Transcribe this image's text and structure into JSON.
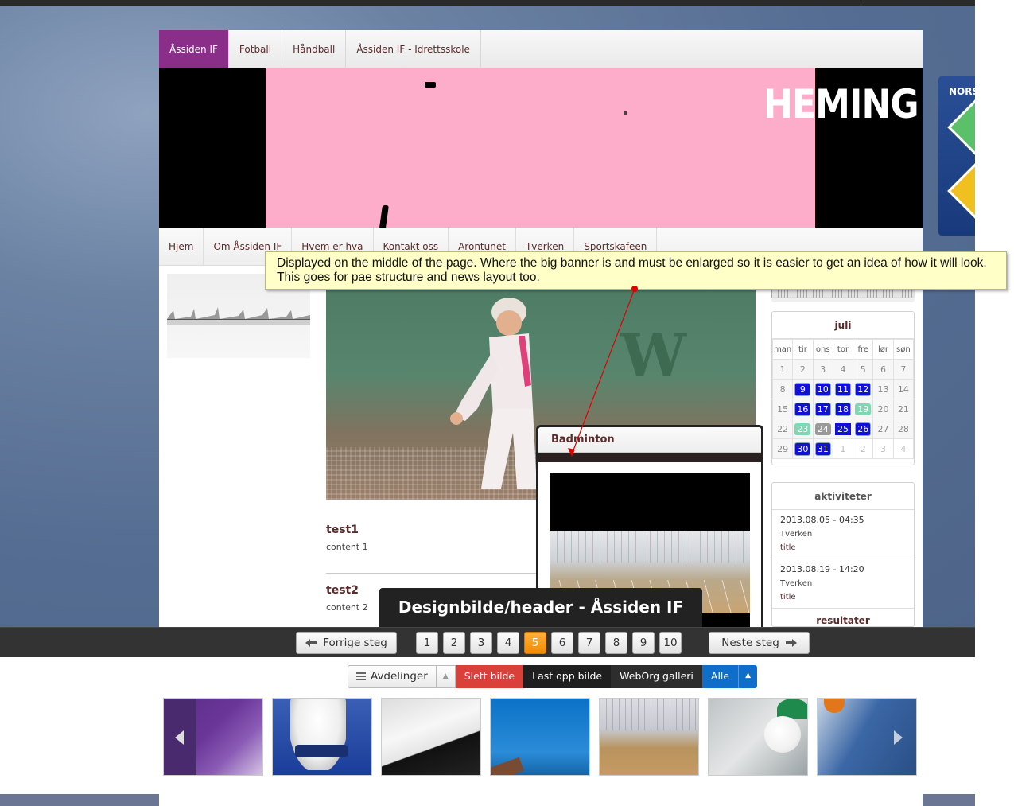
{
  "site": {
    "top_nav": [
      "Åssiden IF",
      "Fotball",
      "Håndball",
      "Åssiden IF - Idrettsskole"
    ],
    "banner_logo": "HEMING",
    "sub_nav": [
      "Hjem",
      "Om Åssiden IF",
      "Hvem er hva",
      "Kontakt oss",
      "Arontunet",
      "Tverken",
      "Sportskafeen"
    ]
  },
  "side_ad": {
    "label": "NORS"
  },
  "articles": [
    {
      "title": "test1",
      "content": "content 1"
    },
    {
      "title": "test2",
      "content": "content 2"
    }
  ],
  "calendar": {
    "month": "juli",
    "weekdays": [
      "man",
      "tir",
      "ons",
      "tor",
      "fre",
      "lør",
      "søn"
    ],
    "weeks": [
      [
        {
          "d": "1"
        },
        {
          "d": "2"
        },
        {
          "d": "3"
        },
        {
          "d": "4"
        },
        {
          "d": "5"
        },
        {
          "d": "6"
        },
        {
          "d": "7"
        }
      ],
      [
        {
          "d": "8"
        },
        {
          "d": "9",
          "s": "ev"
        },
        {
          "d": "10",
          "s": "ev"
        },
        {
          "d": "11",
          "s": "ev"
        },
        {
          "d": "12",
          "s": "ev"
        },
        {
          "d": "13"
        },
        {
          "d": "14"
        }
      ],
      [
        {
          "d": "15"
        },
        {
          "d": "16",
          "s": "ev"
        },
        {
          "d": "17",
          "s": "ev"
        },
        {
          "d": "18",
          "s": "ev"
        },
        {
          "d": "19",
          "s": "green"
        },
        {
          "d": "20"
        },
        {
          "d": "21"
        }
      ],
      [
        {
          "d": "22"
        },
        {
          "d": "23",
          "s": "green"
        },
        {
          "d": "24",
          "s": "gray"
        },
        {
          "d": "25",
          "s": "today"
        },
        {
          "d": "26",
          "s": "ev"
        },
        {
          "d": "27"
        },
        {
          "d": "28"
        }
      ],
      [
        {
          "d": "29"
        },
        {
          "d": "30",
          "s": "ev"
        },
        {
          "d": "31",
          "s": "ev"
        },
        {
          "d": "1",
          "s": "dim"
        },
        {
          "d": "2",
          "s": "dim"
        },
        {
          "d": "3",
          "s": "dim"
        },
        {
          "d": "4",
          "s": "dim"
        }
      ]
    ]
  },
  "activities": {
    "title": "aktiviteter",
    "entries": [
      {
        "date": "2013.08.05 - 04:35",
        "place": "Tverken",
        "title": "title"
      },
      {
        "date": "2013.08.19 - 14:20",
        "place": "Tverken",
        "title": "title"
      }
    ],
    "results_title": "resultater"
  },
  "popup": {
    "title": "Badminton"
  },
  "note": {
    "line1": "Displayed on the middle of the page. Where the big banner is and must be enlarged so it is easier to get an idea of how it will look.",
    "line2": "This goes for pae structure and news layout too."
  },
  "caption": "Designbilde/header - Åssiden IF",
  "steps": {
    "prev_label": "Forrige steg",
    "next_label": "Neste steg",
    "pages": [
      "1",
      "2",
      "3",
      "4",
      "5",
      "6",
      "7",
      "8",
      "9",
      "10"
    ],
    "current": "5"
  },
  "toolbar": {
    "departments": "Avdelinger",
    "delete_image": "Slett bilde",
    "upload_image": "Last opp bilde",
    "gallery": "WebOrg galleri",
    "filter": "Alle"
  },
  "icons": {
    "prev": "arrow-left-icon",
    "next": "arrow-right-icon",
    "departments": "list-icon",
    "carousel_prev": "carousel-prev-icon",
    "carousel_next": "carousel-next-icon"
  },
  "colors": {
    "accent_purple": "#8a2e8a",
    "current_step": "#f28b00",
    "delete": "#d9403a",
    "filter_blue": "#0e6ec9",
    "event_blue": "#1010d8"
  }
}
